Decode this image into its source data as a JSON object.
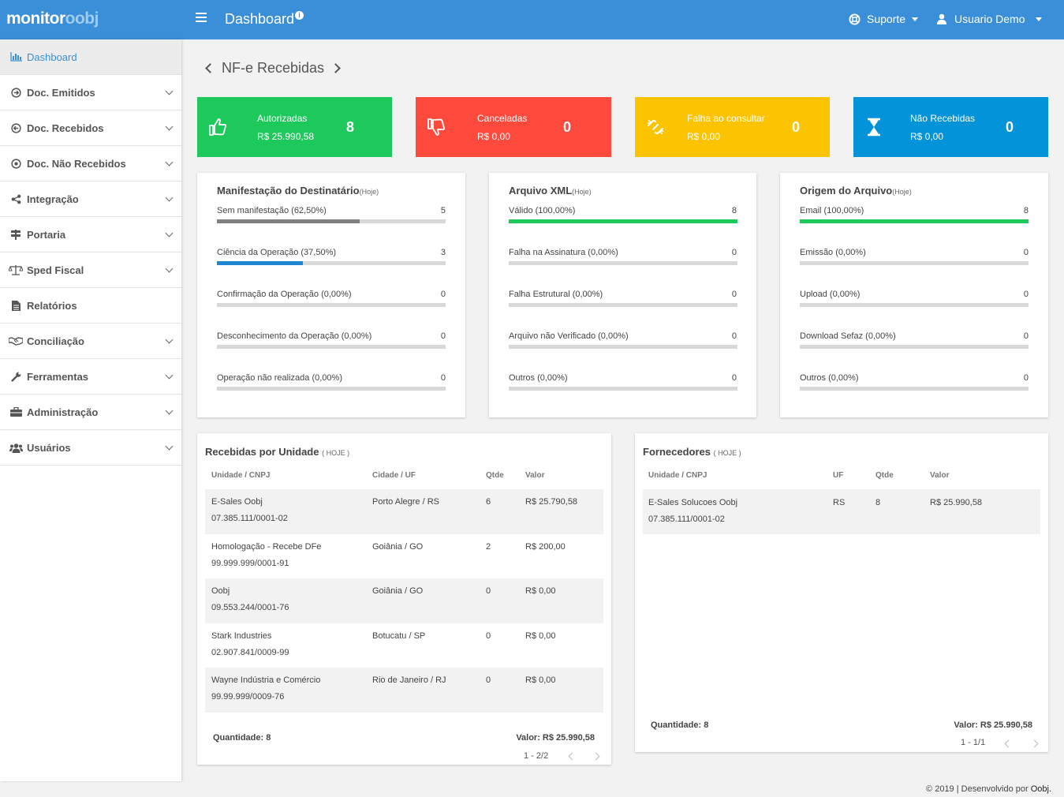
{
  "brand": {
    "part1": "monitor",
    "part2": "oobj"
  },
  "topbar": {
    "title": "Dashboard",
    "info_mark": "i",
    "support": "Suporte",
    "user": "Usuario Demo"
  },
  "sidebar": {
    "items": [
      {
        "label": "Dashboard",
        "icon": "chart-icon"
      },
      {
        "label": "Doc. Emitidos",
        "icon": "arrow-circle-icon"
      },
      {
        "label": "Doc. Recebidos",
        "icon": "arrow-circle-icon"
      },
      {
        "label": "Doc. Não Recebidos",
        "icon": "dot-circle-icon"
      },
      {
        "label": "Integração",
        "icon": "share-icon"
      },
      {
        "label": "Portaria",
        "icon": "signpost-icon"
      },
      {
        "label": "Sped Fiscal",
        "icon": "balance-icon"
      },
      {
        "label": "Relatórios",
        "icon": "file-icon"
      },
      {
        "label": "Conciliação",
        "icon": "handshake-icon"
      },
      {
        "label": "Ferramentas",
        "icon": "wrench-icon"
      },
      {
        "label": "Administração",
        "icon": "briefcase-icon"
      },
      {
        "label": "Usuários",
        "icon": "users-icon"
      }
    ]
  },
  "breadcrumb": {
    "title": "NF-e Recebidas"
  },
  "tiles": [
    {
      "label": "Autorizadas",
      "value": "R$ 25.990,58",
      "count": "8",
      "color": "#1ec95c",
      "icon": "thumbs-up-icon"
    },
    {
      "label": "Canceladas",
      "value": "R$ 0,00",
      "count": "0",
      "color": "#fd4a3d",
      "icon": "thumbs-down-icon"
    },
    {
      "label": "Falha ao consultar",
      "value": "R$ 0,00",
      "count": "0",
      "color": "#fcc400",
      "icon": "broken-link-icon"
    },
    {
      "label": "Não Recebidas",
      "value": "R$ 0,00",
      "count": "0",
      "color": "#0393d9",
      "icon": "hourglass-icon"
    }
  ],
  "cards": {
    "manifestacao": {
      "title": "Manifestação do Destinatário",
      "tag": "(Hoje)",
      "rows": [
        {
          "label": "Sem manifestação (62,50%)",
          "value": "5",
          "pct": 0.625,
          "color": "#808080"
        },
        {
          "label": "Ciência da Operação (37,50%)",
          "value": "3",
          "pct": 0.375,
          "color": "#1f86d1"
        },
        {
          "label": "Confirmação da Operação (0,00%)",
          "value": "0",
          "pct": 0,
          "color": "#808080"
        },
        {
          "label": "Desconhecimento da Operação (0,00%)",
          "value": "0",
          "pct": 0,
          "color": "#808080"
        },
        {
          "label": "Operação não realizada (0,00%)",
          "value": "0",
          "pct": 0,
          "color": "#808080"
        }
      ]
    },
    "xml": {
      "title": "Arquivo XML",
      "tag": "(Hoje)",
      "rows": [
        {
          "label": "Válido (100,00%)",
          "value": "8",
          "pct": 1,
          "color": "#1ec95c"
        },
        {
          "label": "Falha na Assinatura (0,00%)",
          "value": "0",
          "pct": 0,
          "color": "#1ec95c"
        },
        {
          "label": "Falha Estrutural (0,00%)",
          "value": "0",
          "pct": 0,
          "color": "#1ec95c"
        },
        {
          "label": "Arquivo não Verificado (0,00%)",
          "value": "0",
          "pct": 0,
          "color": "#1ec95c"
        },
        {
          "label": "Outros (0,00%)",
          "value": "0",
          "pct": 0,
          "color": "#1ec95c"
        }
      ]
    },
    "origem": {
      "title": "Origem do Arquivo",
      "tag": "(Hoje)",
      "rows": [
        {
          "label": "Email (100,00%)",
          "value": "8",
          "pct": 1,
          "color": "#1ec95c"
        },
        {
          "label": "Emissão (0,00%)",
          "value": "0",
          "pct": 0,
          "color": "#1ec95c"
        },
        {
          "label": "Upload (0,00%)",
          "value": "0",
          "pct": 0,
          "color": "#1ec95c"
        },
        {
          "label": "Download Sefaz (0,00%)",
          "value": "0",
          "pct": 0,
          "color": "#1ec95c"
        },
        {
          "label": "Outros (0,00%)",
          "value": "0",
          "pct": 0,
          "color": "#1ec95c"
        }
      ]
    }
  },
  "unidade": {
    "title": "Recebidas por Unidade",
    "tag": "( HOJE )",
    "headers": [
      "Unidade / CNPJ",
      "Cidade / UF",
      "Qtde",
      "Valor"
    ],
    "rows": [
      {
        "name": "E-Sales Oobj",
        "cnpj": "07.385.111/0001-02",
        "city": "Porto Alegre / RS",
        "qtde": "6",
        "valor": "R$ 25.790,58"
      },
      {
        "name": "Homologação - Recebe DFe",
        "cnpj": "99.999.999/0001-91",
        "city": "Goiânia / GO",
        "qtde": "2",
        "valor": "R$ 200,00"
      },
      {
        "name": "Oobj",
        "cnpj": "09.553.244/0001-76",
        "city": "Goiânia / GO",
        "qtde": "0",
        "valor": "R$ 0,00"
      },
      {
        "name": "Stark Industries",
        "cnpj": "02.907.841/0009-99",
        "city": "Botucatu / SP",
        "qtde": "0",
        "valor": "R$ 0,00"
      },
      {
        "name": "Wayne Indústria e Comércio",
        "cnpj": "99.99.999/0009-76",
        "city": "Rio de Janeiro / RJ",
        "qtde": "0",
        "valor": "R$ 0,00"
      }
    ],
    "quantidade": "Quantidade: 8",
    "valor": "Valor: R$ 25.990,58",
    "page": "1 - 2/2"
  },
  "fornecedores": {
    "title": "Fornecedores",
    "tag": "( HOJE )",
    "headers": [
      "Unidade / CNPJ",
      "UF",
      "Qtde",
      "Valor"
    ],
    "rows": [
      {
        "name": "E-Sales Solucoes Oobj",
        "cnpj": "07.385.111/0001-02",
        "uf": "RS",
        "qtde": "8",
        "valor": "R$ 25.990,58"
      }
    ],
    "quantidade": "Quantidade: 8",
    "valor": "Valor: R$ 25.990,58",
    "page": "1 - 1/1"
  },
  "footer": {
    "text": "© 2019 | Desenvolvido por",
    "brand": "Oobj."
  }
}
